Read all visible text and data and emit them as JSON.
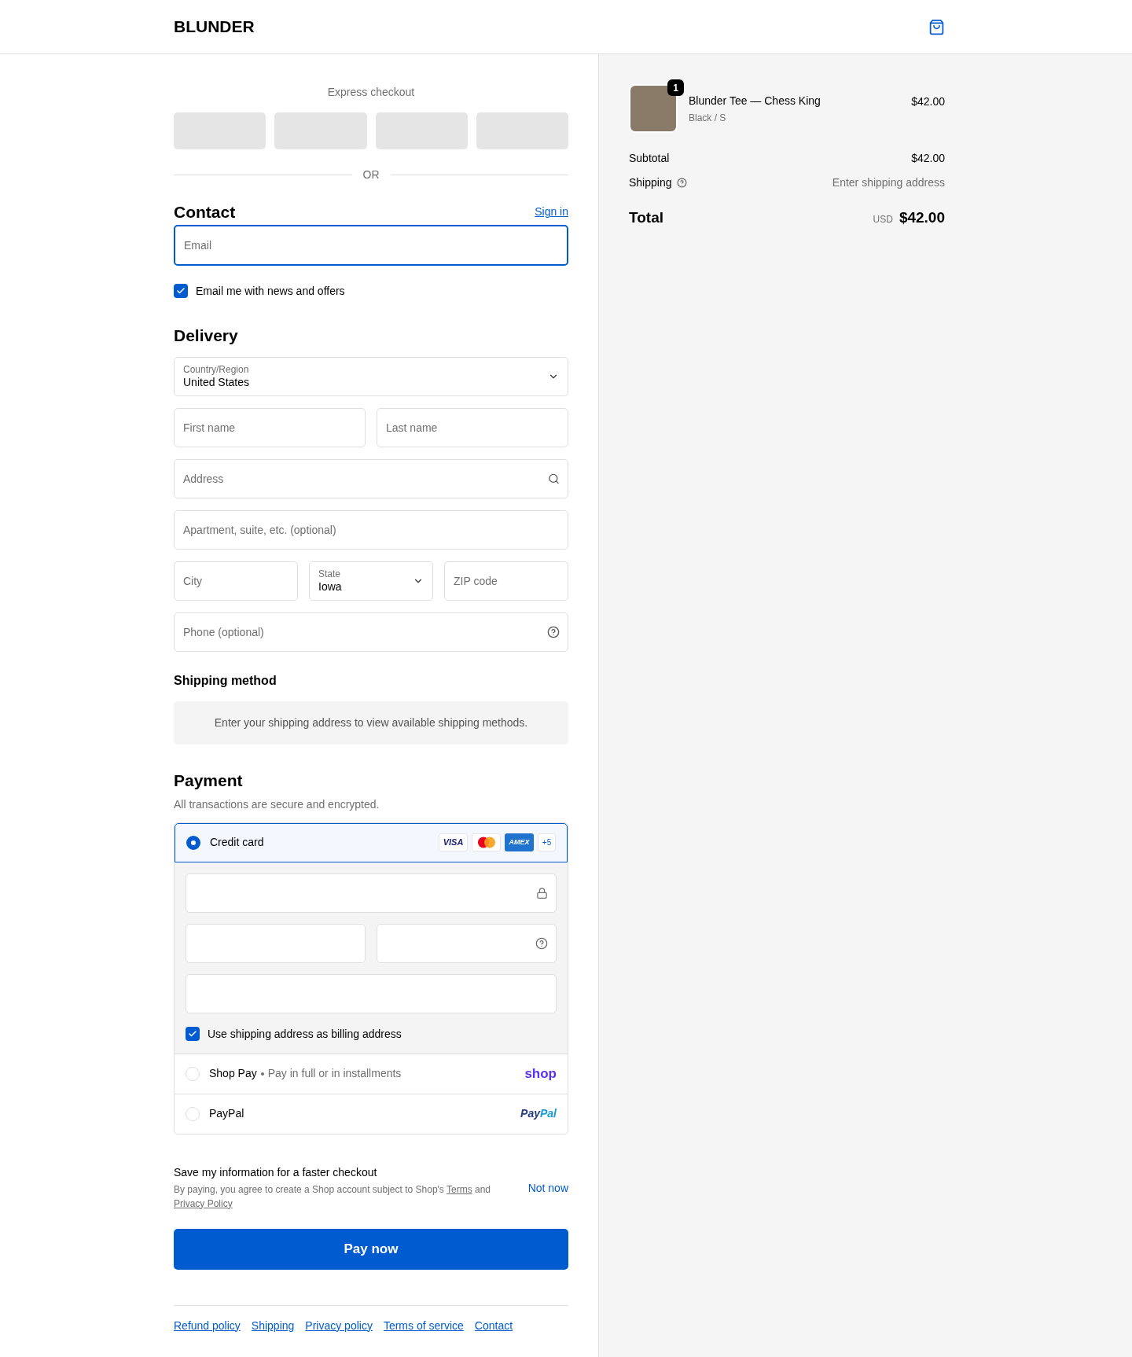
{
  "header": {
    "logo": "BLUNDER"
  },
  "express": {
    "title": "Express checkout",
    "divider": "OR"
  },
  "contact": {
    "title": "Contact",
    "sign_in": "Sign in",
    "email": {
      "placeholder": "Email"
    },
    "news": {
      "label": "Email me with news and offers",
      "checked": true
    }
  },
  "delivery": {
    "title": "Delivery",
    "country": {
      "label": "Country/Region",
      "value": "United States"
    },
    "first_name": {
      "placeholder": "First name"
    },
    "last_name": {
      "placeholder": "Last name"
    },
    "address": {
      "placeholder": "Address"
    },
    "apartment": {
      "placeholder": "Apartment, suite, etc. (optional)"
    },
    "city": {
      "placeholder": "City"
    },
    "state": {
      "label": "State",
      "value": "Iowa"
    },
    "zip": {
      "placeholder": "ZIP code"
    },
    "phone": {
      "placeholder": "Phone (optional)"
    }
  },
  "shipping_method": {
    "title": "Shipping method",
    "notice": "Enter your shipping address to view available shipping methods."
  },
  "payment": {
    "title": "Payment",
    "subtitle": "All transactions are secure and encrypted.",
    "methods": [
      {
        "kind": "card",
        "label": "Credit card",
        "selected": true,
        "brands": [
          "VISA",
          "AMEX"
        ],
        "more": "+5",
        "billing": {
          "label": "Use shipping address as billing address",
          "checked": true
        }
      },
      {
        "kind": "shoppay",
        "label": "Shop Pay",
        "note": "Pay in full or in installments",
        "logo": "shop",
        "selected": false
      },
      {
        "kind": "paypal",
        "label": "PayPal",
        "logo_a": "Pay",
        "logo_b": "Pal",
        "selected": false
      }
    ]
  },
  "save_info": {
    "title": "Save my information for a faster checkout",
    "before": "By paying, you agree to create a Shop account subject to Shop's ",
    "terms": "Terms",
    "middle": " and ",
    "privacy": "Privacy Policy",
    "dismiss": "Not now"
  },
  "pay_button": "Pay now",
  "footer_links": [
    "Refund policy",
    "Shipping",
    "Privacy policy",
    "Terms of service",
    "Contact"
  ],
  "summary": {
    "item": {
      "title": "Blunder Tee — Chess King",
      "variant": "Black / S",
      "price": "$42.00",
      "quantity": "1"
    },
    "subtotal": {
      "label": "Subtotal",
      "value": "$42.00"
    },
    "shipping": {
      "label": "Shipping",
      "value": "Enter shipping address"
    },
    "total": {
      "label": "Total",
      "currency": "USD",
      "value": "$42.00"
    }
  }
}
